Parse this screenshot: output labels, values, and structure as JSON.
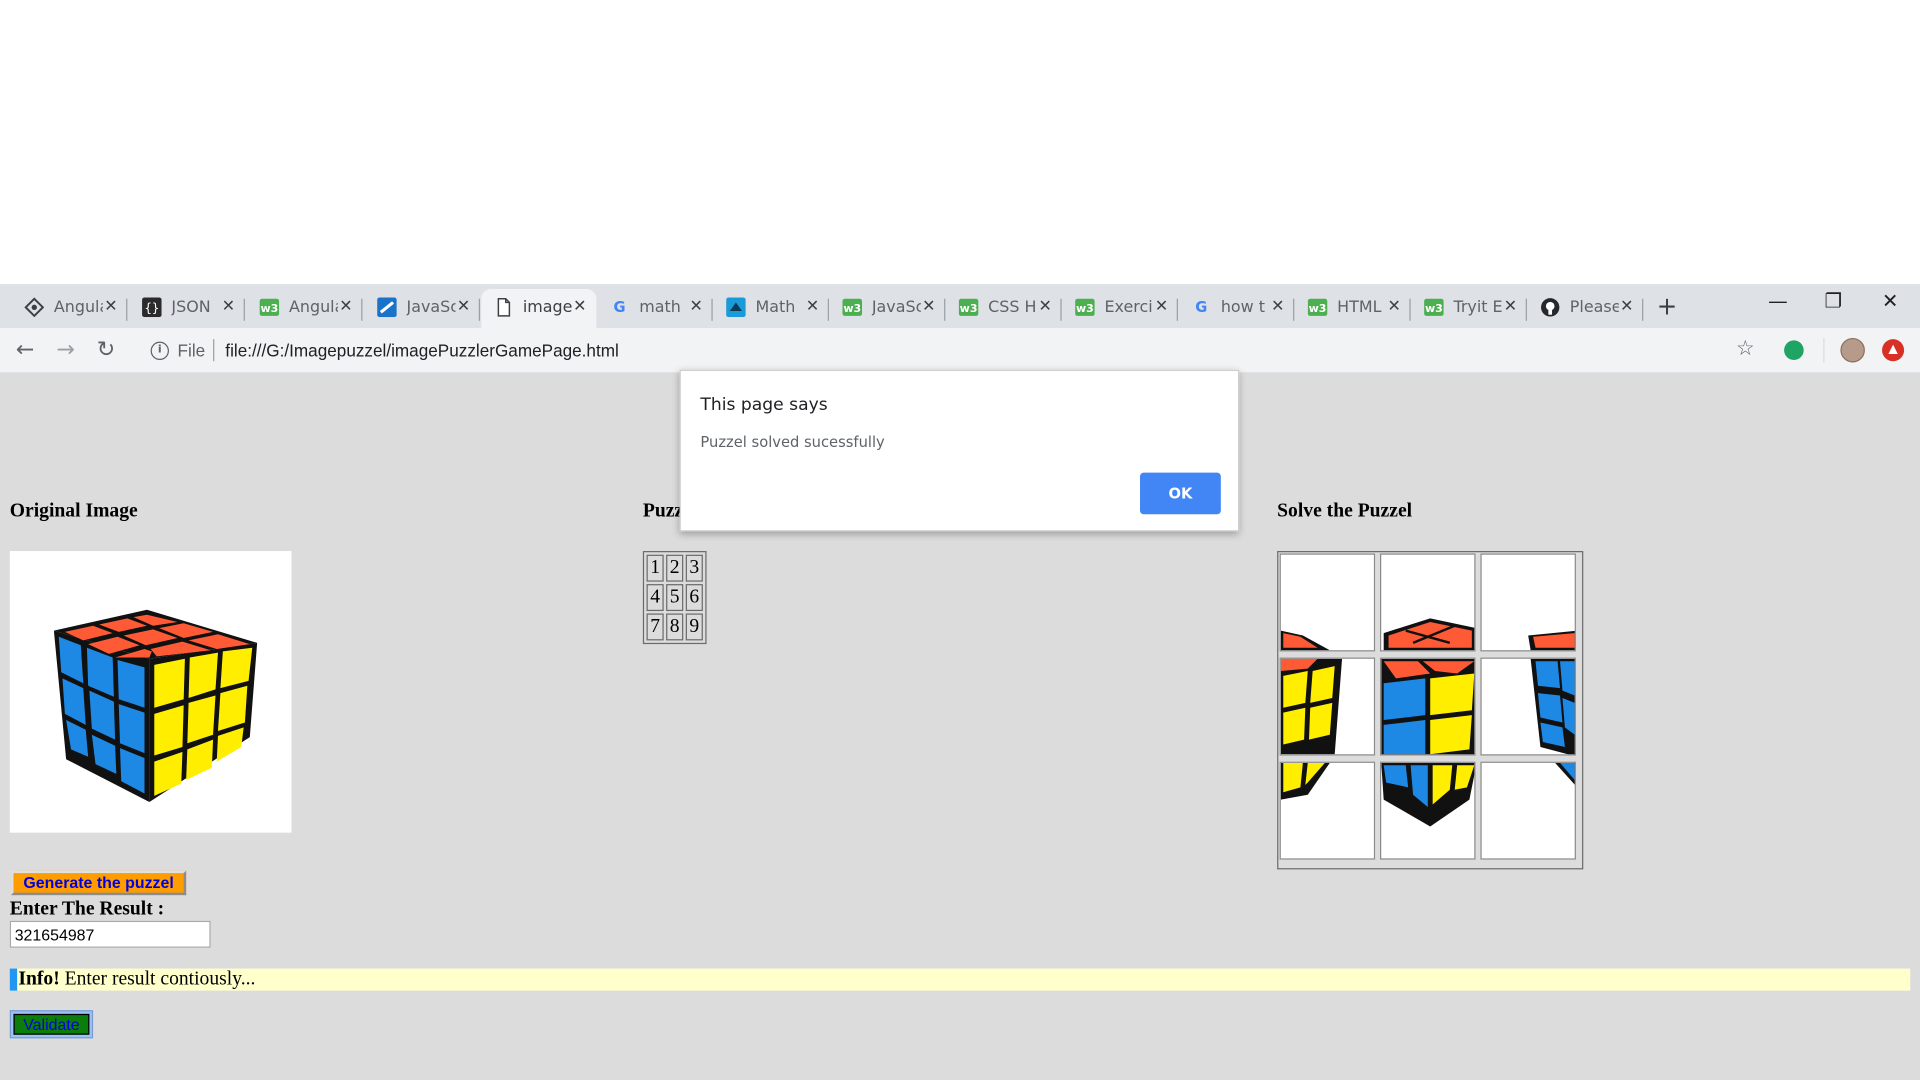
{
  "tabs": [
    {
      "title": "Angular",
      "icon": "angular-diamond-icon",
      "active": false
    },
    {
      "title": "JSON",
      "icon": "json-braces-icon",
      "active": false
    },
    {
      "title": "Angular",
      "icon": "w3schools-icon",
      "active": false
    },
    {
      "title": "JavaScript",
      "icon": "javascript-site-icon",
      "active": false
    },
    {
      "title": "image",
      "icon": "document-icon",
      "active": true
    },
    {
      "title": "math",
      "icon": "google-icon",
      "active": false
    },
    {
      "title": "Math",
      "icon": "math-site-icon",
      "active": false
    },
    {
      "title": "JavaScript",
      "icon": "w3schools-icon",
      "active": false
    },
    {
      "title": "CSS H",
      "icon": "w3schools-icon",
      "active": false
    },
    {
      "title": "Exercise",
      "icon": "w3schools-icon",
      "active": false
    },
    {
      "title": "how t",
      "icon": "google-icon",
      "active": false
    },
    {
      "title": "HTML",
      "icon": "w3schools-icon",
      "active": false
    },
    {
      "title": "Tryit E",
      "icon": "w3schools-icon",
      "active": false
    },
    {
      "title": "Please",
      "icon": "github-icon",
      "active": false
    }
  ],
  "toolbar": {
    "scheme_label": "File",
    "url": "file:///G:/Imagepuzzel/imagePuzzlerGamePage.html"
  },
  "page": {
    "original_heading": "Original Image",
    "puzzle_heading": "Puzzle",
    "solve_heading": "Solve the Puzzel",
    "number_grid": [
      [
        "1",
        "2",
        "3"
      ],
      [
        "4",
        "5",
        "6"
      ],
      [
        "7",
        "8",
        "9"
      ]
    ],
    "generate_label": "Generate the puzzel",
    "result_label": "Enter The Result :",
    "result_value": "321654987",
    "info_strong": "Info!",
    "info_text": " Enter result contiously...",
    "validate_label": "Validate"
  },
  "dialog": {
    "title": "This page says",
    "message": "Puzzel solved sucessfully",
    "ok_label": "OK"
  },
  "colors": {
    "cube_red": "#ff5a36",
    "cube_blue": "#1e88e5",
    "cube_yellow": "#ffee00",
    "generate_button": "#ff9d00",
    "validate_button": "#0a7d0a",
    "info_background": "#ffffcc",
    "info_accent": "#2196f3",
    "dialog_ok": "#4285f4",
    "page_background": "#dcdcdc"
  }
}
